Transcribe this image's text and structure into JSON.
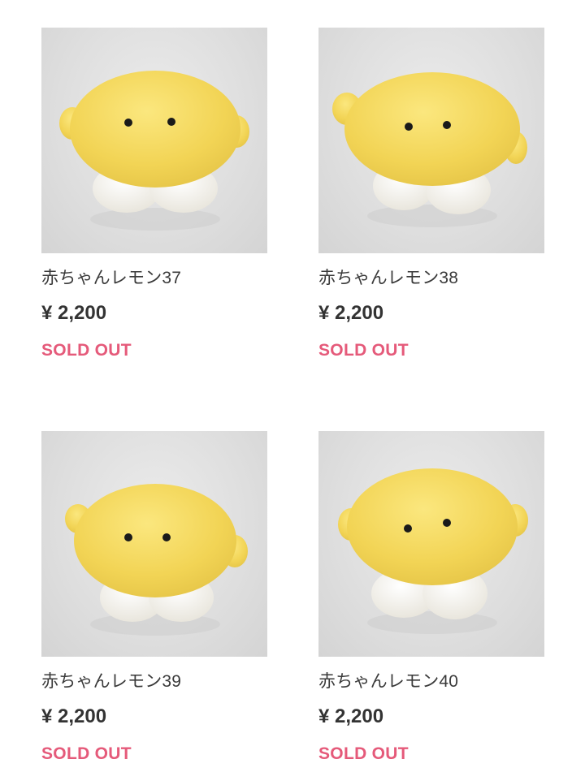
{
  "products": [
    {
      "name": "赤ちゃんレモン37",
      "price": "¥ 2,200",
      "status": "SOLD OUT",
      "image_subject": "yellow-lemon-plush"
    },
    {
      "name": "赤ちゃんレモン38",
      "price": "¥ 2,200",
      "status": "SOLD OUT",
      "image_subject": "yellow-lemon-plush"
    },
    {
      "name": "赤ちゃんレモン39",
      "price": "¥ 2,200",
      "status": "SOLD OUT",
      "image_subject": "yellow-lemon-plush"
    },
    {
      "name": "赤ちゃんレモン40",
      "price": "¥ 2,200",
      "status": "SOLD OUT",
      "image_subject": "yellow-lemon-plush"
    }
  ],
  "colors": {
    "status_sold_out": "#e55a7a",
    "plush_body": "#f4d85a",
    "plush_feet": "#f5f3ec"
  }
}
